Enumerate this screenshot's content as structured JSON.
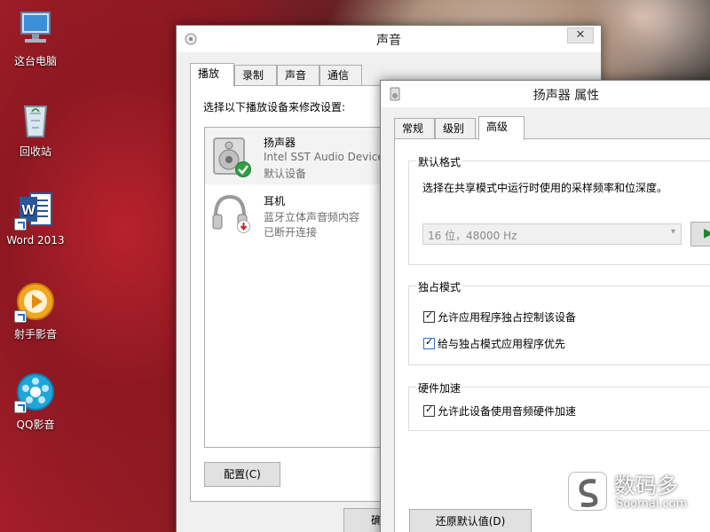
{
  "desktop": {
    "icons": [
      {
        "label": "这台电脑",
        "icon": "computer-icon"
      },
      {
        "label": "回收站",
        "icon": "recycle-bin-icon"
      },
      {
        "label": "Word 2013",
        "icon": "word-icon"
      },
      {
        "label": "射手影音",
        "icon": "shooter-player-icon"
      },
      {
        "label": "QQ影音",
        "icon": "qq-player-icon"
      }
    ]
  },
  "sound_window": {
    "title": "声音",
    "close_label": "✕",
    "tabs": [
      "播放",
      "录制",
      "声音",
      "通信"
    ],
    "active_tab": "播放",
    "instruction": "选择以下播放设备来修改设置:",
    "devices": [
      {
        "name": "扬声器",
        "detail": "Intel SST Audio Device",
        "status": "默认设备",
        "icon": "speaker-icon",
        "badge": "default-check-icon"
      },
      {
        "name": "耳机",
        "detail": "蓝牙立体声音频内容",
        "status": "已断开连接",
        "icon": "headphones-icon",
        "badge": "disconnected-icon"
      }
    ],
    "configure_label": "配置(C)",
    "ok_label_partial": "确"
  },
  "props_window": {
    "title": "扬声器 属性",
    "tabs": [
      "常规",
      "级别",
      "高级"
    ],
    "active_tab": "高级",
    "default_format": {
      "group_title": "默认格式",
      "description": "选择在共享模式中运行时使用的采样频率和位深度。",
      "selected_format": "16 位，48000 Hz"
    },
    "exclusive_mode": {
      "group_title": "独占模式",
      "options": [
        {
          "label": "允许应用程序独占控制该设备",
          "checked": true
        },
        {
          "label": "给与独占模式应用程序优先",
          "checked": true
        }
      ]
    },
    "hardware_acceleration": {
      "group_title": "硬件加速",
      "options": [
        {
          "label": "允许此设备使用音频硬件加速",
          "checked": true
        }
      ]
    },
    "restore_defaults_label": "还原默认值(D)"
  },
  "watermark": {
    "brand": "数码多",
    "domain": "Soomal.com"
  }
}
